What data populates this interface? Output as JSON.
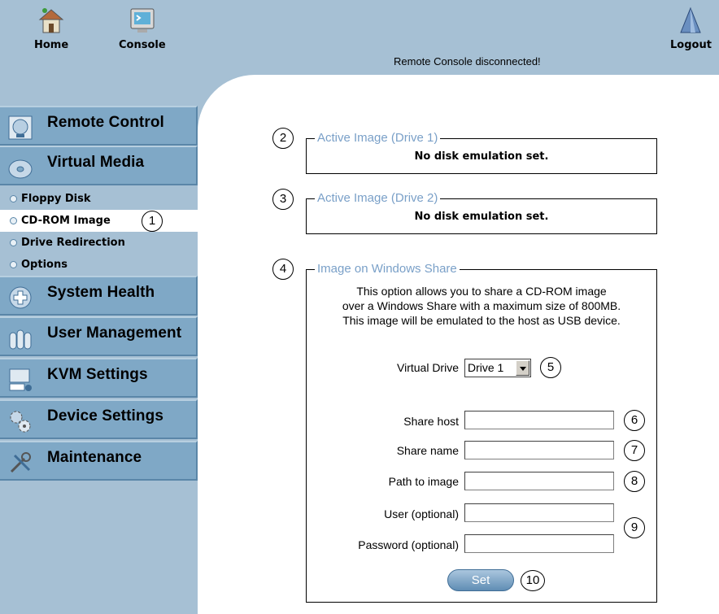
{
  "topbar": {
    "home_label": "Home",
    "console_label": "Console",
    "status": "Remote Console disconnected!",
    "logout_label": "Logout"
  },
  "sidebar": {
    "items": [
      {
        "label": "Remote Control",
        "icon": "monitor-icon"
      },
      {
        "label": "Virtual Media",
        "icon": "disc-icon"
      },
      {
        "label": "System Health",
        "icon": "health-icon"
      },
      {
        "label": "User Management",
        "icon": "users-icon"
      },
      {
        "label": "KVM Settings",
        "icon": "keyboard-monitor-icon"
      },
      {
        "label": "Device Settings",
        "icon": "gears-icon"
      },
      {
        "label": "Maintenance",
        "icon": "tools-icon"
      }
    ],
    "subitems": [
      {
        "label": "Floppy Disk"
      },
      {
        "label": "CD-ROM Image",
        "active": true
      },
      {
        "label": "Drive Redirection"
      },
      {
        "label": "Options"
      }
    ]
  },
  "callouts": [
    "1",
    "2",
    "3",
    "4",
    "5",
    "6",
    "7",
    "8",
    "9",
    "10"
  ],
  "drive1": {
    "title": "Active Image (Drive 1)",
    "status": "No disk emulation set."
  },
  "drive2": {
    "title": "Active Image (Drive 2)",
    "status": "No disk emulation set."
  },
  "share": {
    "title": "Image on Windows Share",
    "desc_line1": "This option allows you to share a CD-ROM image",
    "desc_line2": "over a Windows Share with a maximum size of 800MB.",
    "desc_line3": "This image will be emulated to the host as USB device.",
    "virtual_drive_label": "Virtual Drive",
    "virtual_drive_value": "Drive 1",
    "share_host_label": "Share host",
    "share_host_value": "",
    "share_name_label": "Share name",
    "share_name_value": "",
    "path_label": "Path to image",
    "path_value": "",
    "user_label": "User (optional)",
    "user_value": "",
    "password_label": "Password (optional)",
    "password_value": "",
    "set_label": "Set"
  },
  "colors": {
    "sidebar_bg": "#a6c0d4",
    "nav_bg": "#7fa8c6",
    "legend": "#7aa0c8",
    "button": "#5f8db4"
  }
}
